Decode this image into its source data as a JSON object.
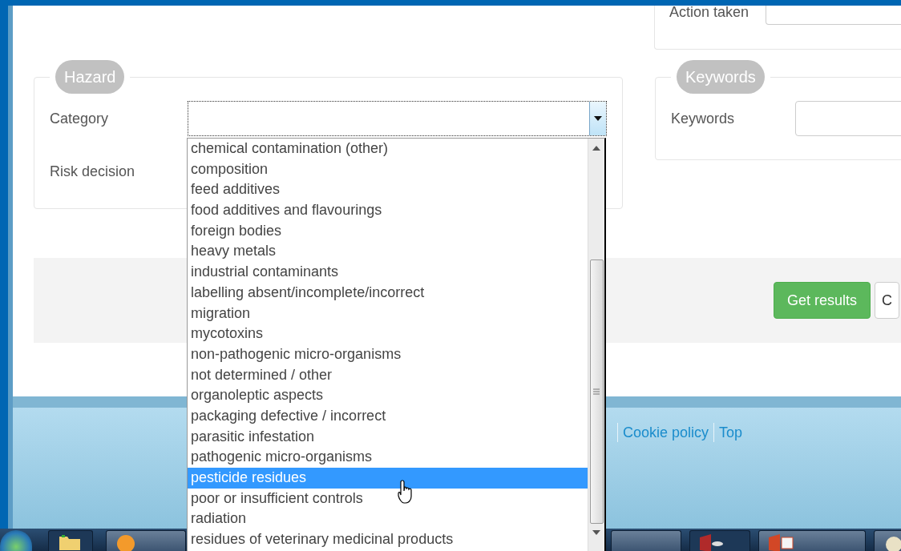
{
  "action_panel": {
    "label": "Action taken"
  },
  "hazard": {
    "legend": "Hazard",
    "fields": [
      {
        "label": "Category"
      },
      {
        "label": "Risk decision"
      }
    ]
  },
  "category_dropdown": {
    "options": [
      {
        "label": "chemical contamination (other)",
        "selected": false
      },
      {
        "label": "composition",
        "selected": false
      },
      {
        "label": "feed additives",
        "selected": false
      },
      {
        "label": "food additives and flavourings",
        "selected": false
      },
      {
        "label": "foreign bodies",
        "selected": false
      },
      {
        "label": "heavy metals",
        "selected": false
      },
      {
        "label": "industrial contaminants",
        "selected": false
      },
      {
        "label": "labelling absent/incomplete/incorrect",
        "selected": false
      },
      {
        "label": "migration",
        "selected": false
      },
      {
        "label": "mycotoxins",
        "selected": false
      },
      {
        "label": "non-pathogenic micro-organisms",
        "selected": false
      },
      {
        "label": "not determined / other",
        "selected": false
      },
      {
        "label": "organoleptic aspects",
        "selected": false
      },
      {
        "label": "packaging defective / incorrect",
        "selected": false
      },
      {
        "label": "parasitic infestation",
        "selected": false
      },
      {
        "label": "pathogenic micro-organisms",
        "selected": false
      },
      {
        "label": "pesticide residues",
        "selected": true
      },
      {
        "label": "poor or insufficient controls",
        "selected": false
      },
      {
        "label": "radiation",
        "selected": false
      },
      {
        "label": "residues of veterinary medicinal products",
        "selected": false
      }
    ]
  },
  "keywords": {
    "legend": "Keywords",
    "fields": [
      {
        "label": "Keywords"
      }
    ]
  },
  "buttons": [
    {
      "label": "Get results",
      "kind": "primary"
    },
    {
      "label": "C",
      "kind": "default"
    }
  ],
  "footer": {
    "links": [
      "Cookie policy",
      "Top"
    ]
  }
}
